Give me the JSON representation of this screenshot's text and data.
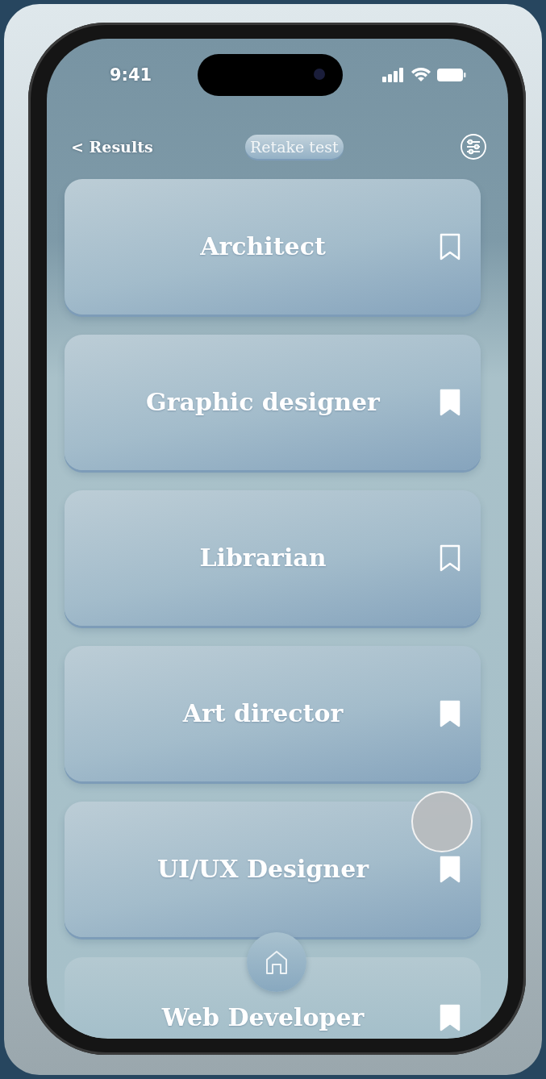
{
  "status_bar": {
    "time": "9:41"
  },
  "nav": {
    "back_label": "< Results",
    "retake_button": "Retake test"
  },
  "careers": [
    {
      "title": "Architect",
      "bookmarked": false
    },
    {
      "title": "Graphic designer",
      "bookmarked": true
    },
    {
      "title": "Librarian",
      "bookmarked": false
    },
    {
      "title": "Art director",
      "bookmarked": true
    },
    {
      "title": "UI/UX Designer",
      "bookmarked": true
    },
    {
      "title": "Web Developer",
      "bookmarked": true
    }
  ]
}
